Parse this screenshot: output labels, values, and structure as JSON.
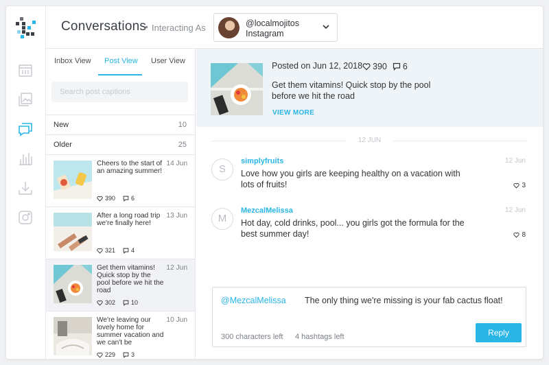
{
  "header": {
    "title": "Conversations",
    "separator": "•",
    "interacting_label": "Interacting As",
    "account": {
      "handle": "@localmojitos",
      "network": "Instagram"
    }
  },
  "sidebar": {
    "icons": [
      "calendar-icon",
      "media-library-icon",
      "conversations-icon",
      "analytics-icon",
      "download-icon",
      "instagram-icon"
    ],
    "active": "conversations-icon"
  },
  "tabs": {
    "items": [
      "Inbox View",
      "Post View",
      "User View"
    ],
    "active": "Post View"
  },
  "search": {
    "placeholder": "Search post captions",
    "value": ""
  },
  "sections": [
    {
      "label": "New",
      "count": "10"
    },
    {
      "label": "Older",
      "count": "25"
    }
  ],
  "posts": [
    {
      "caption": "Cheers to the start of an amazing summer!",
      "date": "14 Jun",
      "likes": "390",
      "comments": "6"
    },
    {
      "caption": "After a long road trip we're finally here!",
      "date": "13 Jun",
      "likes": "321",
      "comments": "4"
    },
    {
      "caption": "Get them vitamins! Quick stop by the pool before we hit the road",
      "date": "12 Jun",
      "likes": "302",
      "comments": "10"
    },
    {
      "caption": "We're leaving our lovely home for summer vacation and we can't be",
      "date": "10 Jun",
      "likes": "229",
      "comments": "3"
    }
  ],
  "selected_post": {
    "posted": "Posted on Jun 12, 2018",
    "likes": "390",
    "comments": "6",
    "caption": "Get them vitamins! Quick stop by the pool before we hit the road",
    "view_more": "VIEW MORE"
  },
  "thread": {
    "date_divider": "12 JUN",
    "comments": [
      {
        "initial": "S",
        "user": "simplyfruits",
        "date": "12 Jun",
        "text": "Love how you girls are keeping healthy on a vacation with lots of fruits!",
        "likes": "3"
      },
      {
        "initial": "M",
        "user": "MezcalMelissa",
        "date": "12 Jun",
        "text": "Hot day, cold drinks, pool... you girls got the formula for the best summer day!",
        "likes": "8"
      }
    ]
  },
  "reply": {
    "mention": "@MezcalMelissa",
    "message": "The only thing we're missing is your fab cactus float!",
    "chars_left": "300 characters left",
    "hashtags_left": "4 hashtags left",
    "button": "Reply"
  },
  "colors": {
    "accent": "#29b6e6",
    "hero_bg": "#eef4f8",
    "selected_bg": "#f0f2f5"
  }
}
